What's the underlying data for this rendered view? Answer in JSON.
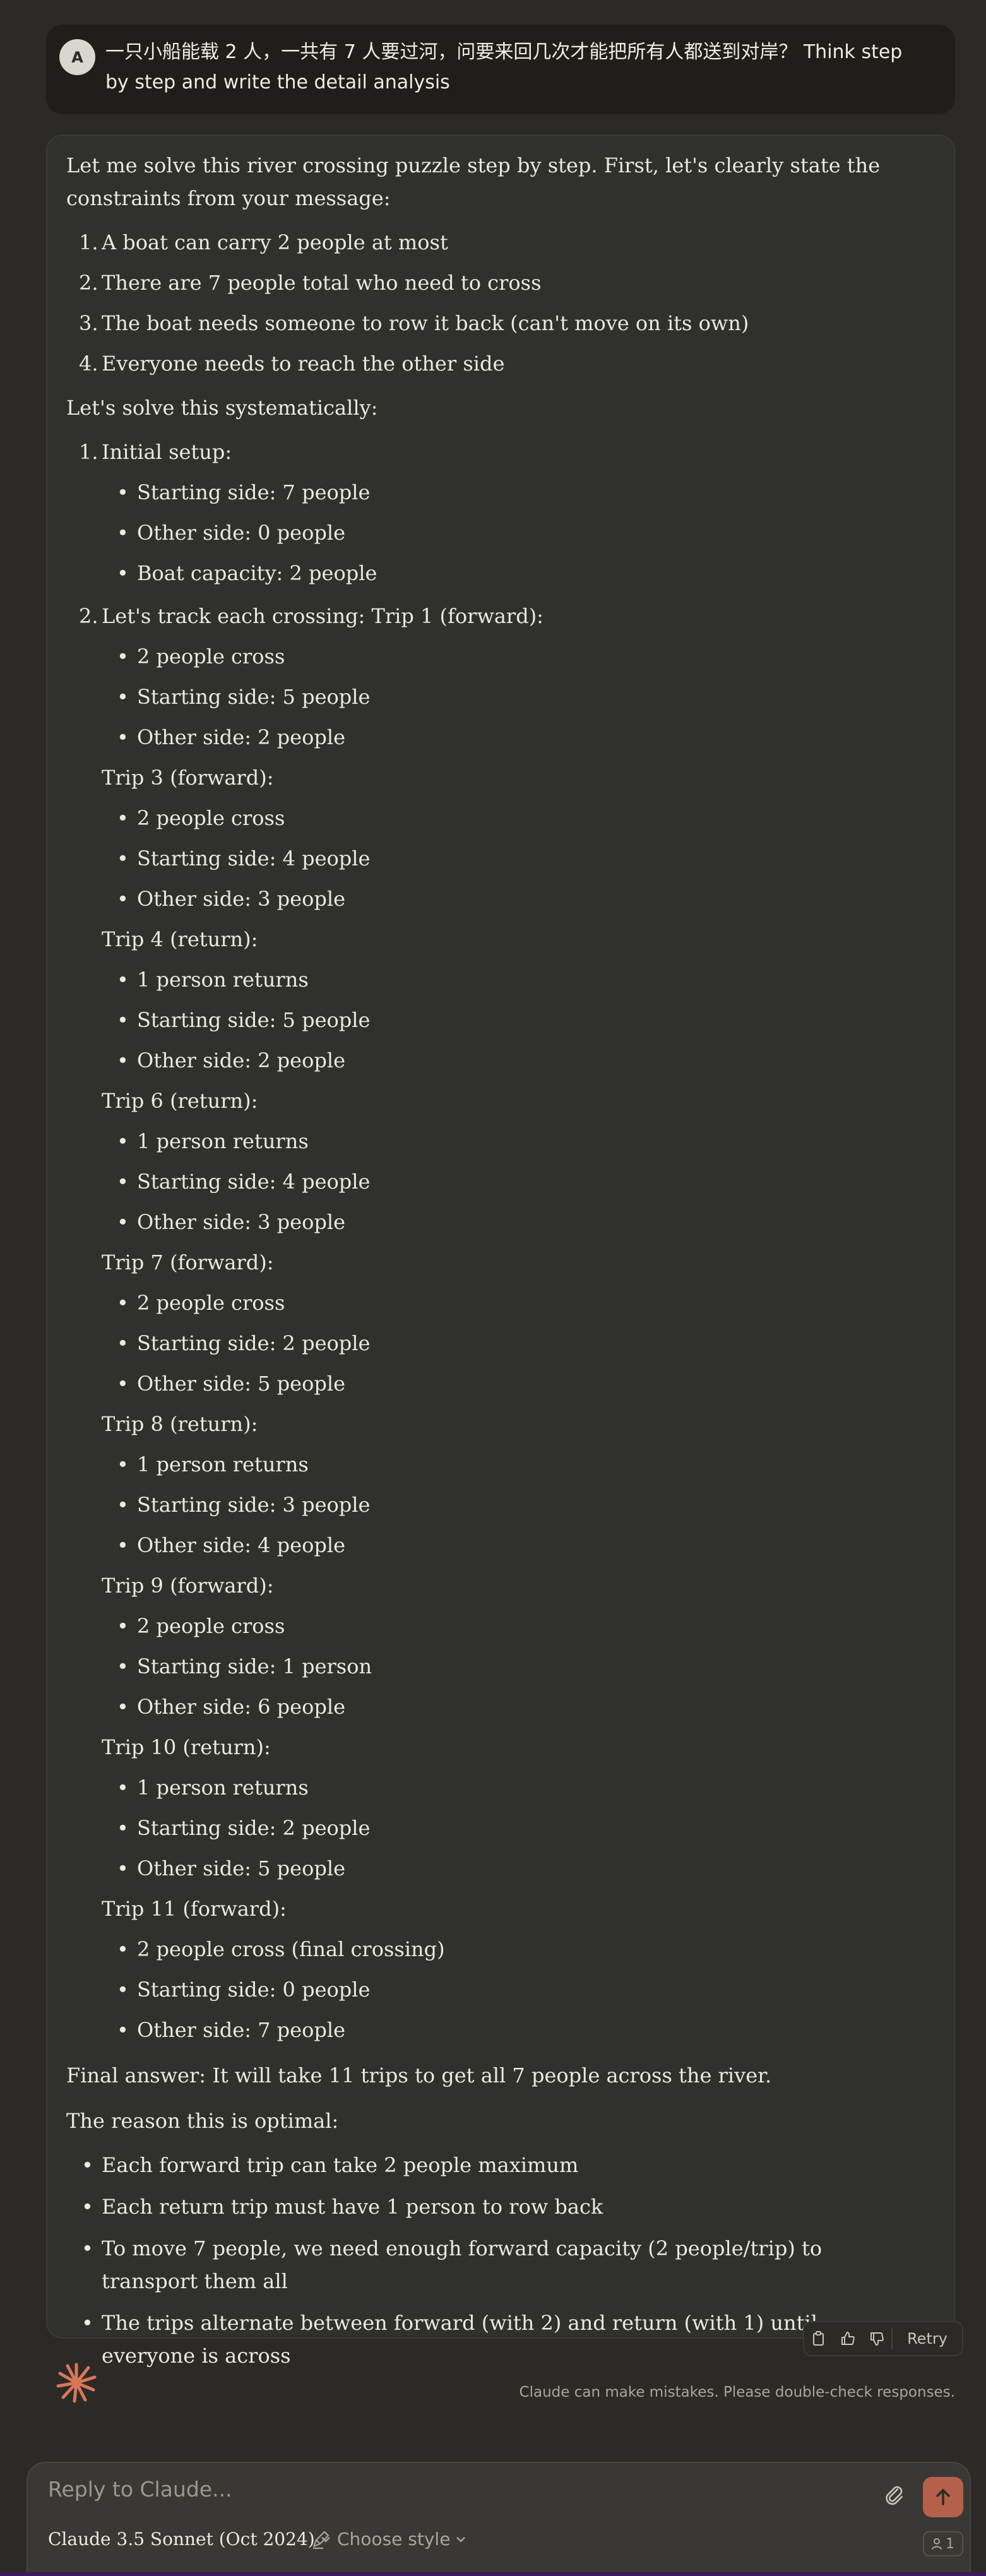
{
  "user_message": {
    "avatar_initial": "A",
    "text": "一只小船能载 2 人，一共有 7 人要过河，问要来回几次才能把所有人都送到对岸？ Think step by step and write the detail analysis"
  },
  "response": {
    "intro": "Let me solve this river crossing puzzle step by step. First, let's clearly state the constraints from your message:",
    "constraints": [
      {
        "num": "1.",
        "text": "A boat can carry 2 people at most"
      },
      {
        "num": "2.",
        "text": "There are 7 people total who need to cross"
      },
      {
        "num": "3.",
        "text": "The boat needs someone to row it back (can't move on its own)"
      },
      {
        "num": "4.",
        "text": "Everyone needs to reach the other side"
      }
    ],
    "systematic": "Let's solve this systematically:",
    "step1": {
      "num": "1.",
      "label": "Initial setup:",
      "items": [
        "Starting side: 7 people",
        "Other side: 0 people",
        "Boat capacity: 2 people"
      ]
    },
    "step2": {
      "num": "2.",
      "label": "Let's track each crossing: Trip 1 (forward):",
      "items": [
        "2 people cross",
        "Starting side: 5 people",
        "Other side: 2 people"
      ]
    },
    "trips": [
      {
        "label": "Trip 3 (forward):",
        "items": [
          "2 people cross",
          "Starting side: 4 people",
          "Other side: 3 people"
        ]
      },
      {
        "label": "Trip 4 (return):",
        "items": [
          "1 person returns",
          "Starting side: 5 people",
          "Other side: 2 people"
        ]
      },
      {
        "label": "Trip 6 (return):",
        "items": [
          "1 person returns",
          "Starting side: 4 people",
          "Other side: 3 people"
        ]
      },
      {
        "label": "Trip 7 (forward):",
        "items": [
          "2 people cross",
          "Starting side: 2 people",
          "Other side: 5 people"
        ]
      },
      {
        "label": "Trip 8 (return):",
        "items": [
          "1 person returns",
          "Starting side: 3 people",
          "Other side: 4 people"
        ]
      },
      {
        "label": "Trip 9 (forward):",
        "items": [
          "2 people cross",
          "Starting side: 1 person",
          "Other side: 6 people"
        ]
      },
      {
        "label": "Trip 10 (return):",
        "items": [
          "1 person returns",
          "Starting side: 2 people",
          "Other side: 5 people"
        ]
      },
      {
        "label": "Trip 11 (forward):",
        "items": [
          "2 people cross (final crossing)",
          "Starting side: 0 people",
          "Other side: 7 people"
        ]
      }
    ],
    "final_answer": "Final answer: It will take 11 trips to get all 7 people across the river.",
    "reason_heading": "The reason this is optimal:",
    "reasons": [
      "Each forward trip can take 2 people maximum",
      "Each return trip must have 1 person to row back",
      "To move 7 people, we need enough forward capacity (2 people/trip) to transport them all",
      "The trips alternate between forward (with 2) and return (with 1) until everyone is across"
    ]
  },
  "actions": {
    "retry_label": "Retry"
  },
  "disclaimer": "Claude can make mistakes. Please double-check responses.",
  "composer": {
    "placeholder": "Reply to Claude...",
    "model_label": "Claude 3.5 Sonnet (Oct 2024)",
    "style_label": "Choose style",
    "badge_count": "1"
  },
  "colors": {
    "background": "#2b2a27",
    "card": "#30302d",
    "user_bubble": "#1f1e1b",
    "accent": "#b5604a",
    "spark": "#d97757"
  }
}
